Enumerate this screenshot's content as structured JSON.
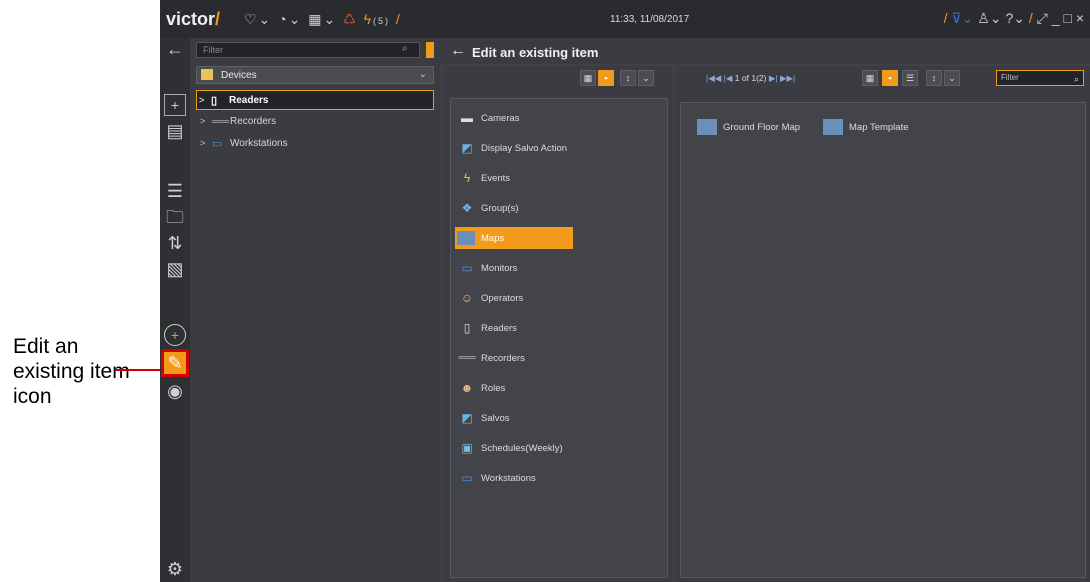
{
  "annotation": {
    "callout_text": "Edit an existing item icon"
  },
  "app": {
    "logo": "victor",
    "datetime": "11:33, 11/08/2017",
    "alerts_count": "(5)",
    "colors": {
      "accent": "#f29a1a",
      "background": "#3b3d42",
      "highlight_border": "#d40000"
    }
  },
  "devices_panel": {
    "filter_placeholder": "Filter",
    "dropdown_label": "Devices",
    "tree": [
      {
        "label": "Readers",
        "icon": "reader-icon",
        "selected": true
      },
      {
        "label": "Recorders",
        "icon": "recorder-icon",
        "selected": false
      },
      {
        "label": "Workstations",
        "icon": "workstation-icon",
        "selected": false
      }
    ]
  },
  "main": {
    "header_title": "Edit an existing item",
    "types": [
      {
        "label": "Cameras",
        "icon": "camera-icon"
      },
      {
        "label": "Display Salvo Action",
        "icon": "salvo-action-icon"
      },
      {
        "label": "Events",
        "icon": "lightning-icon"
      },
      {
        "label": "Group(s)",
        "icon": "group-icon"
      },
      {
        "label": "Maps",
        "icon": "map-icon",
        "selected": true
      },
      {
        "label": "Monitors",
        "icon": "monitor-icon"
      },
      {
        "label": "Operators",
        "icon": "operator-icon"
      },
      {
        "label": "Readers",
        "icon": "reader-icon"
      },
      {
        "label": "Recorders",
        "icon": "recorder-icon"
      },
      {
        "label": "Roles",
        "icon": "roles-icon"
      },
      {
        "label": "Salvos",
        "icon": "salvo-icon"
      },
      {
        "label": "Schedules(Weekly)",
        "icon": "schedule-icon"
      },
      {
        "label": "Workstations",
        "icon": "workstation-icon"
      }
    ],
    "pager_text": "1 of 1(2)",
    "item_filter_placeholder": "Filter",
    "items": [
      {
        "label": "Ground Floor Map",
        "icon": "map-icon"
      },
      {
        "label": "Map Template",
        "icon": "map-icon"
      }
    ]
  }
}
